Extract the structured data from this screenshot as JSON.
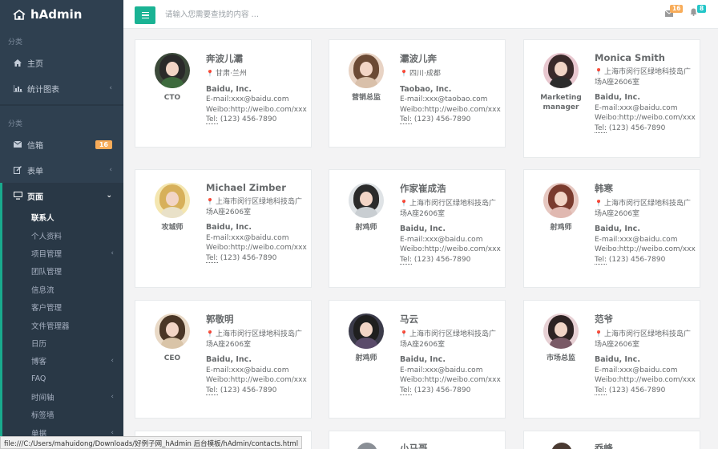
{
  "brand": {
    "title": "hAdmin"
  },
  "sidebar": {
    "group1_label": "分类",
    "group2_label": "分类",
    "items_top": [
      {
        "label": "主页",
        "icon": "home-icon"
      },
      {
        "label": "统计图表",
        "icon": "bar-chart-icon"
      }
    ],
    "items_mid": [
      {
        "label": "信箱",
        "icon": "envelope-icon",
        "badge": "16"
      },
      {
        "label": "表单",
        "icon": "edit-icon"
      },
      {
        "label": "页面",
        "icon": "desktop-icon"
      }
    ],
    "subitems": [
      {
        "label": "联系人"
      },
      {
        "label": "个人资料"
      },
      {
        "label": "项目管理"
      },
      {
        "label": "团队管理"
      },
      {
        "label": "信息流"
      },
      {
        "label": "客户管理"
      },
      {
        "label": "文件管理器"
      },
      {
        "label": "日历"
      },
      {
        "label": "博客"
      },
      {
        "label": "FAQ"
      },
      {
        "label": "时间轴"
      },
      {
        "label": "标签墙"
      },
      {
        "label": "单据"
      }
    ]
  },
  "topbar": {
    "search_placeholder": "请输入您需要查找的内容 …",
    "mail_count": "16",
    "notify_count": "8",
    "colors": {
      "accent": "#1ab394",
      "mail_badge": "#f8ac59",
      "notify_badge": "#23c6c8"
    }
  },
  "contacts": [
    {
      "name": "奔波儿灞",
      "role": "CTO",
      "addr": "甘肃·兰州",
      "company": "Baidu, Inc.",
      "email": "E-mail:xxx@baidu.com",
      "weibo": "Weibo:http://weibo.com/xxx",
      "tel_label": "Tel:",
      "tel": "(123) 456-7890"
    },
    {
      "name": "灞波儿奔",
      "role": "营销总监",
      "addr": "四川·成都",
      "company": "Taobao, Inc.",
      "email": "E-mail:xxx@taobao.com",
      "weibo": "Weibo:http://weibo.com/xxx",
      "tel_label": "Tel:",
      "tel": "(123) 456-7890"
    },
    {
      "name": "Monica Smith",
      "role": "Marketing manager",
      "addr": "上海市闵行区绿地科技岛广场A座2606室",
      "company": "Baidu, Inc.",
      "email": "E-mail:xxx@baidu.com",
      "weibo": "Weibo:http://weibo.com/xxx",
      "tel_label": "Tel:",
      "tel": "(123) 456-7890"
    },
    {
      "name": "Michael Zimber",
      "role": "攻城师",
      "addr": "上海市闵行区绿地科技岛广场A座2606室",
      "company": "Baidu, Inc.",
      "email": "E-mail:xxx@baidu.com",
      "weibo": "Weibo:http://weibo.com/xxx",
      "tel_label": "Tel:",
      "tel": "(123) 456-7890"
    },
    {
      "name": "作家崔成浩",
      "role": "射鸡师",
      "addr": "上海市闵行区绿地科技岛广场A座2606室",
      "company": "Baidu, Inc.",
      "email": "E-mail:xxx@baidu.com",
      "weibo": "Weibo:http://weibo.com/xxx",
      "tel_label": "Tel:",
      "tel": "(123) 456-7890"
    },
    {
      "name": "韩寒",
      "role": "射鸡师",
      "addr": "上海市闵行区绿地科技岛广场A座2606室",
      "company": "Baidu, Inc.",
      "email": "E-mail:xxx@baidu.com",
      "weibo": "Weibo:http://weibo.com/xxx",
      "tel_label": "Tel:",
      "tel": "(123) 456-7890"
    },
    {
      "name": "郭敬明",
      "role": "CEO",
      "addr": "上海市闵行区绿地科技岛广场A座2606室",
      "company": "Baidu, Inc.",
      "email": "E-mail:xxx@baidu.com",
      "weibo": "Weibo:http://weibo.com/xxx",
      "tel_label": "Tel:",
      "tel": "(123) 456-7890"
    },
    {
      "name": "马云",
      "role": "射鸡师",
      "addr": "上海市闵行区绿地科技岛广场A座2606室",
      "company": "Baidu, Inc.",
      "email": "E-mail:xxx@baidu.com",
      "weibo": "Weibo:http://weibo.com/xxx",
      "tel_label": "Tel:",
      "tel": "(123) 456-7890"
    },
    {
      "name": "范爷",
      "role": "市场总监",
      "addr": "上海市闵行区绿地科技岛广场A座2606室",
      "company": "Baidu, Inc.",
      "email": "E-mail:xxx@baidu.com",
      "weibo": "Weibo:http://weibo.com/xxx",
      "tel_label": "Tel:",
      "tel": "(123) 456-7890"
    }
  ],
  "partial_row": [
    {
      "name": "小马哥"
    },
    {
      "name": "乔峰"
    }
  ],
  "statusbar": {
    "text": "file:///C:/Users/mahuidong/Downloads/好例子网_hAdmin 后台模板/hAdmin/contacts.html"
  }
}
